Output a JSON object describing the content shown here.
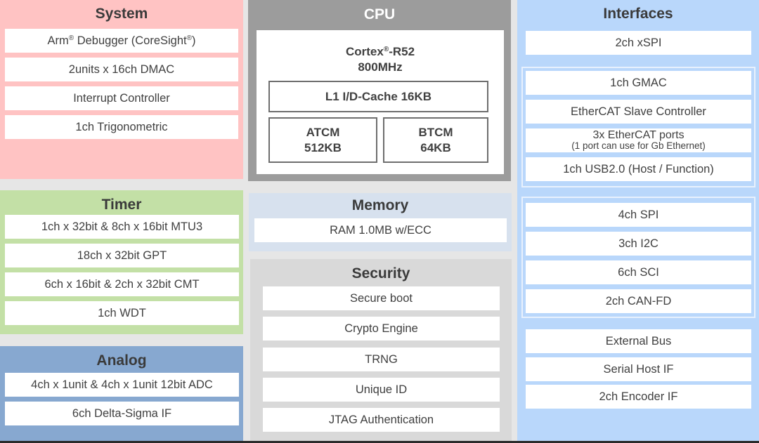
{
  "system": {
    "title": "System",
    "items": [
      {
        "text": "Arm",
        "sup": "®",
        "rest": " Debugger (CoreSight",
        "sup2": "®",
        "end": ")"
      },
      {
        "text": "2units x 16ch DMAC"
      },
      {
        "text": "Interrupt Controller"
      },
      {
        "text": "1ch Trigonometric"
      }
    ]
  },
  "timer": {
    "title": "Timer",
    "items": [
      "1ch x 32bit & 8ch x 16bit MTU3",
      "18ch x 32bit GPT",
      "6ch x 16bit & 2ch x 32bit CMT",
      "1ch WDT"
    ]
  },
  "analog": {
    "title": "Analog",
    "items": [
      "4ch x 1unit & 4ch x 1unit 12bit ADC",
      "6ch Delta-Sigma IF"
    ]
  },
  "cpu": {
    "title": "CPU",
    "core": {
      "name": "Cortex",
      "sup": "®",
      "suffix": "-R52",
      "freq": "800MHz"
    },
    "cache": "L1 I/D-Cache 16KB",
    "atcm": {
      "name": "ATCM",
      "size": "512KB"
    },
    "btcm": {
      "name": "BTCM",
      "size": "64KB"
    }
  },
  "memory": {
    "title": "Memory",
    "items": [
      "RAM 1.0MB w/ECC"
    ]
  },
  "security": {
    "title": "Security",
    "items": [
      "Secure boot",
      "Crypto Engine",
      "TRNG",
      "Unique ID",
      "JTAG Authentication"
    ]
  },
  "interfaces": {
    "title": "Interfaces",
    "top": "2ch xSPI",
    "ethernet_group": [
      {
        "line1": "1ch GMAC"
      },
      {
        "line1": "EtherCAT Slave Controller"
      },
      {
        "line1": "3x EtherCAT ports",
        "line2": "(1 port can use for Gb Ethernet)"
      },
      {
        "line1": "1ch USB2.0 (Host / Function)"
      }
    ],
    "serial_group": [
      "4ch SPI",
      "3ch I2C",
      "6ch SCI",
      "2ch CAN-FD"
    ],
    "other": [
      "External Bus",
      "Serial Host IF",
      "2ch Encoder IF"
    ]
  },
  "colors": {
    "system": "#ffc3c3",
    "timer": "#c3e0a6",
    "analog": "#87a8d0",
    "cpu": "#9c9c9c",
    "memory": "#d7e1ee",
    "security": "#d9d9d9",
    "interfaces": "#b9d7fb"
  }
}
